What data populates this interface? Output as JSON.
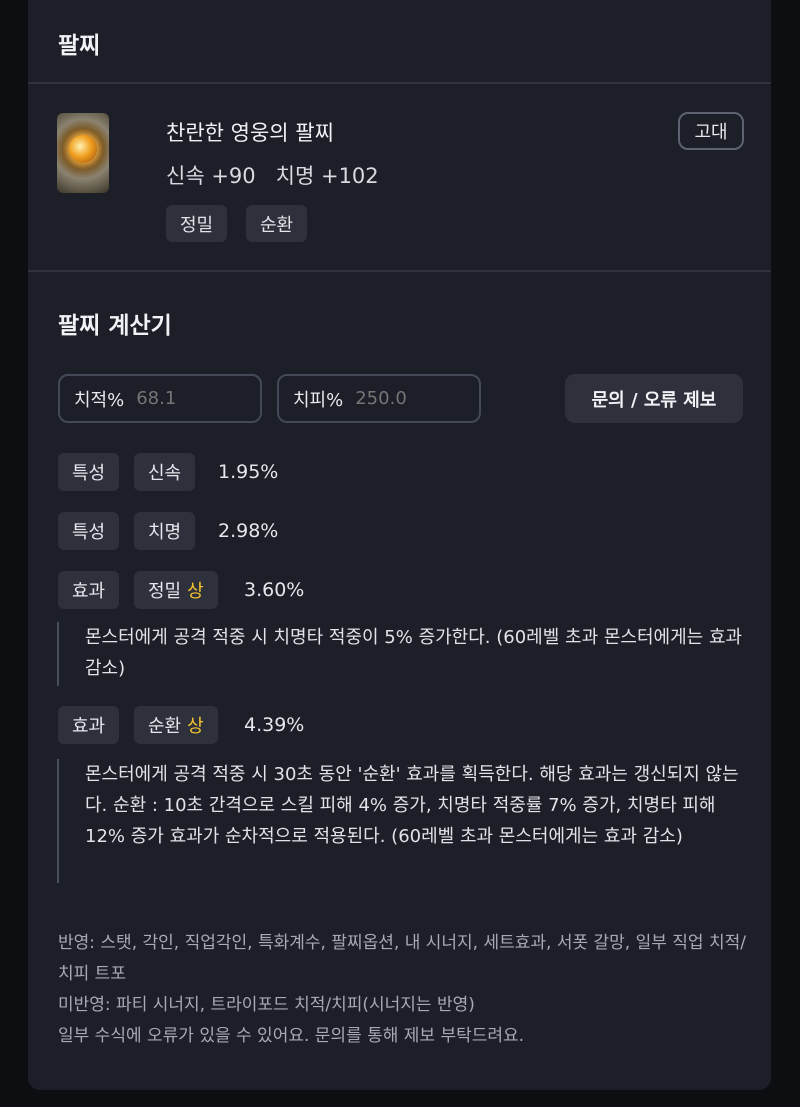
{
  "header": {
    "title": "팔찌"
  },
  "item": {
    "name": "찬란한 영웅의 팔찌",
    "grade": "고대",
    "stats": "신속 +90   치명 +102",
    "tags": [
      "정밀",
      "순환"
    ]
  },
  "calculator": {
    "title": "팔찌 계산기",
    "crit_rate": {
      "label": "치적%",
      "placeholder": "68.1"
    },
    "crit_dmg": {
      "label": "치피%",
      "placeholder": "250.0"
    },
    "report_label": "문의 / 오류 제보",
    "rows": [
      {
        "kind": "특성",
        "name": "신속",
        "grade": "",
        "value": "1.95%"
      },
      {
        "kind": "특성",
        "name": "치명",
        "grade": "",
        "value": "2.98%"
      },
      {
        "kind": "효과",
        "name": "정밀",
        "grade": "상",
        "value": "3.60%",
        "desc": "몬스터에게 공격 적중 시 치명타 적중이 5% 증가한다. (60레벨 초과 몬스터에게는 효과 감소)"
      },
      {
        "kind": "효과",
        "name": "순환",
        "grade": "상",
        "value": "4.39%",
        "desc": "몬스터에게 공격 적중 시 30초 동안 '순환' 효과를 획득한다. 해당 효과는 갱신되지 않는다. 순환 : 10초 간격으로 스킬 피해 4% 증가, 치명타 적중률 7% 증가, 치명타 피해 12% 증가 효과가 순차적으로 적용된다. (60레벨 초과 몬스터에게는 효과 감소)"
      }
    ]
  },
  "footer": {
    "applied": "반영: 스탯, 각인, 직업각인, 특화계수, 팔찌옵션, 내 시너지, 세트효과, 서폿 갈망, 일부 직업 치적/치피 트포",
    "not_applied": "미반영: 파티 시너지, 트라이포드 치적/치피(시너지는 반영)",
    "notice": "일부 수식에 오류가 있을 수 있어요. 문의를 통해 제보 부탁드려요."
  }
}
